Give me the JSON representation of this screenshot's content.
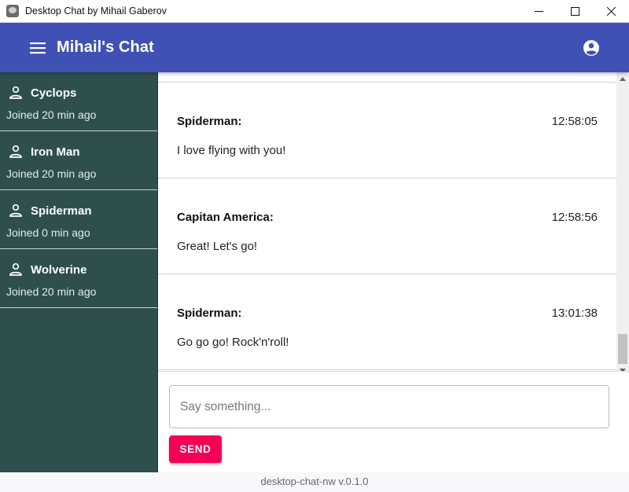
{
  "window": {
    "title": "Desktop Chat by Mihail Gaberov"
  },
  "appbar": {
    "title": "Mihail's Chat"
  },
  "sidebar": {
    "users": [
      {
        "name": "Cyclops",
        "joined": "Joined 20 min ago"
      },
      {
        "name": "Iron Man",
        "joined": "Joined 20 min ago"
      },
      {
        "name": "Spiderman",
        "joined": "Joined 0 min ago"
      },
      {
        "name": "Wolverine",
        "joined": "Joined 20 min ago"
      }
    ]
  },
  "messages": [
    {
      "author": "Spiderman:",
      "time": "12:58:05",
      "text": "I love flying with you!"
    },
    {
      "author": "Capitan America:",
      "time": "12:58:56",
      "text": "Great! Let's go!"
    },
    {
      "author": "Spiderman:",
      "time": "13:01:38",
      "text": "Go go go! Rock'n'roll!"
    }
  ],
  "composer": {
    "placeholder": "Say something...",
    "value": "",
    "send_label": "SEND"
  },
  "footer": {
    "version": "desktop-chat-nw v.0.1.0"
  },
  "colors": {
    "appbar": "#3f51b5",
    "sidebar": "#2f4f4f",
    "send_button": "#f50057"
  },
  "icons": {
    "menu": "menu-icon",
    "account": "account-circle-icon",
    "user": "person-outline-icon"
  }
}
